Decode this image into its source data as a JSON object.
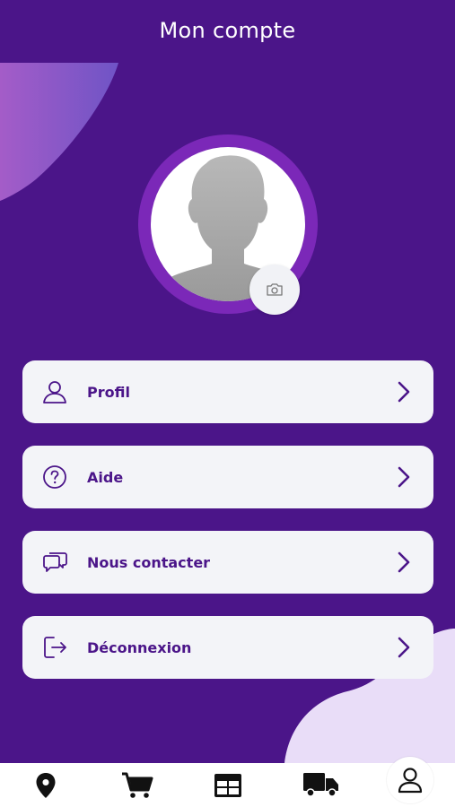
{
  "header": {
    "title": "Mon compte"
  },
  "menu": [
    {
      "label": "Profil",
      "icon": "user-icon"
    },
    {
      "label": "Aide",
      "icon": "help-circle-icon"
    },
    {
      "label": "Nous contacter",
      "icon": "chat-icon"
    },
    {
      "label": "Déconnexion",
      "icon": "logout-icon"
    }
  ],
  "bottom_nav": [
    {
      "icon": "location-pin-icon"
    },
    {
      "icon": "cart-icon"
    },
    {
      "icon": "table-icon"
    },
    {
      "icon": "truck-icon"
    },
    {
      "icon": "account-icon",
      "active": true
    }
  ],
  "colors": {
    "background": "#4b1589",
    "card": "#f3f4f8",
    "accent": "#7b28b8",
    "text": "#4b1589"
  }
}
